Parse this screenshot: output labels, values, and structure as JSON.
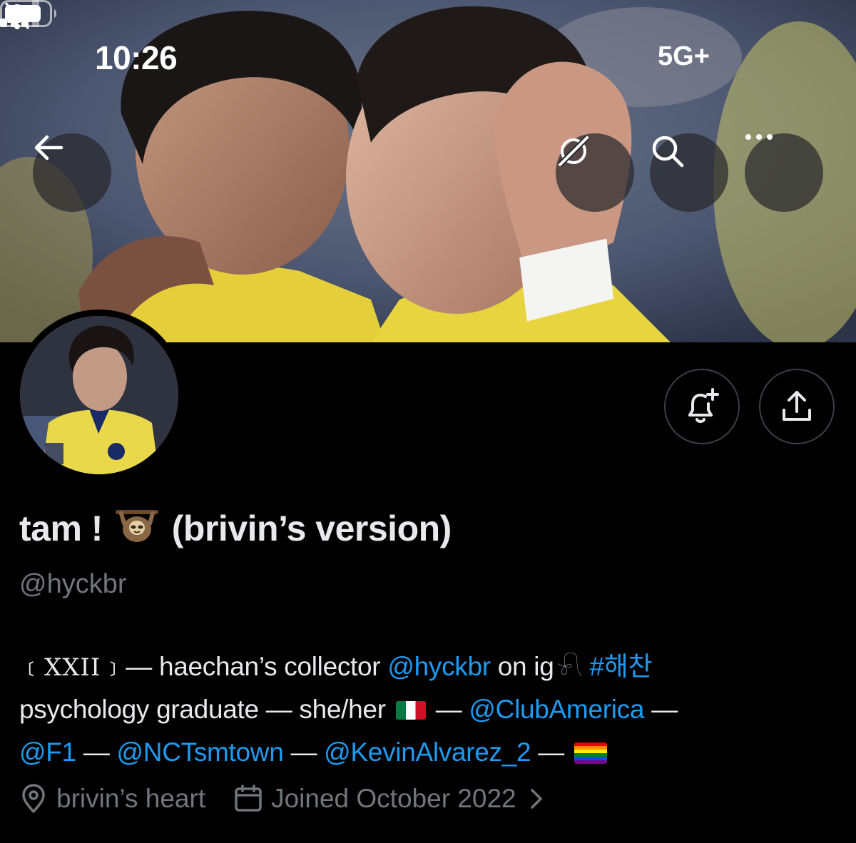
{
  "status_bar": {
    "time": "10:26",
    "network": "5G+",
    "bell_icon": "bell-slash-icon",
    "signal_icon": "cellular-signal-icon",
    "battery_icon": "battery-icon"
  },
  "header_buttons": {
    "back_icon": "arrow-left-icon",
    "grok_icon": "grok-icon",
    "search_icon": "search-icon",
    "more_icon": "more-horizontal-icon"
  },
  "profile_actions": {
    "notify_icon": "bell-plus-icon",
    "share_icon": "share-icon"
  },
  "profile": {
    "name_prefix": "tam !",
    "name_emoji": "sloth-emoji",
    "name_suffix": "(brivin’s version)",
    "handle": "@hyckbr",
    "bio": {
      "line1": {
        "bracket_text": "﹝XXII﹞",
        "text1": "— haechan’s collector ",
        "mention1": "@hyckbr",
        "text2": " on ig",
        "hook_glyph": "𓍯",
        "hashtag": "#해찬"
      },
      "line2": {
        "text1": "psychology graduate — she/her ",
        "flag_icon": "mexico-flag-emoji",
        "text2": " — ",
        "mention": "@ClubAmerica",
        "text3": " —"
      },
      "line3": {
        "mention1": "@F1",
        "sep1": " — ",
        "mention2": "@NCTsmtown",
        "sep2": " — ",
        "mention3": "@KevinAlvarez_2",
        "sep3": " — ",
        "flag_icon": "rainbow-flag-emoji"
      }
    },
    "location": "brivin’s heart",
    "joined": "Joined October 2022",
    "location_icon": "location-pin-icon",
    "calendar_icon": "calendar-icon"
  },
  "colors": {
    "background": "#000000",
    "text_primary": "#e7e9ea",
    "text_secondary": "#71767b",
    "link": "#1d9bf0",
    "button_border": "#3b3f44"
  }
}
